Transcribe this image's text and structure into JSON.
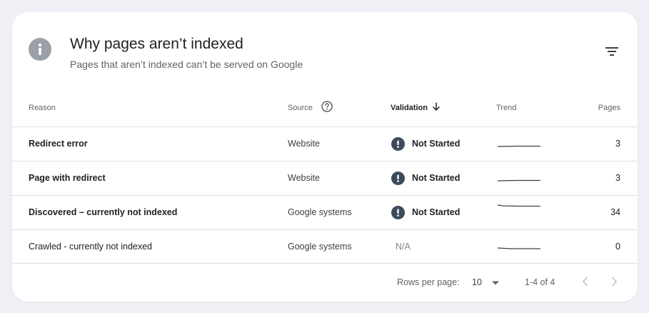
{
  "header": {
    "title": "Why pages aren’t indexed",
    "subtitle": "Pages that aren’t indexed can’t be served on Google",
    "icon": "info-icon",
    "filter_icon": "filter-icon"
  },
  "columns": {
    "reason": "Reason",
    "source": "Source",
    "validation": "Validation",
    "trend": "Trend",
    "pages": "Pages"
  },
  "rows": [
    {
      "reason": "Redirect error",
      "source": "Website",
      "validation": "Not Started",
      "pages": "3"
    },
    {
      "reason": "Page with redirect",
      "source": "Website",
      "validation": "Not Started",
      "pages": "3"
    },
    {
      "reason": "Discovered – currently not indexed",
      "source": "Google systems",
      "validation": "Not Started",
      "pages": "34"
    },
    {
      "reason": "Crawled - currently not indexed",
      "source": "Google systems",
      "validation": "N/A",
      "pages": "0"
    }
  ],
  "footer": {
    "rows_per_page_label": "Rows per page:",
    "rows_per_page_value": "10",
    "range": "1-4 of 4"
  },
  "colors": {
    "status_badge": "#3c4b5c",
    "info_icon": "#9aa0a6",
    "trend_line": "#3c4043"
  }
}
